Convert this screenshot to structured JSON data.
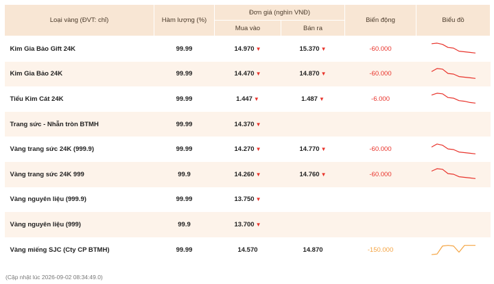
{
  "table": {
    "headers": {
      "name": "Loại vàng (ĐVT: chỉ)",
      "purity": "Hàm lượng (%)",
      "price_group": "Đơn giá (nghìn VNĐ)",
      "buy": "Mua vào",
      "sell": "Bán ra",
      "change": "Biến động",
      "chart": "Biểu đồ"
    },
    "rows": [
      {
        "name": "Kim Gia Bảo Gift 24K",
        "purity": "99.99",
        "buy": "14.970",
        "buy_arrow": "▼",
        "sell": "15.370",
        "sell_arrow": "▼",
        "change": "-60.000",
        "trend": [
          0.9,
          0.95,
          0.85,
          0.6,
          0.55,
          0.3,
          0.25,
          0.2,
          0.15
        ],
        "trend_color": "#e8322a"
      },
      {
        "name": "Kim Gia Bảo 24K",
        "purity": "99.99",
        "buy": "14.470",
        "buy_arrow": "▼",
        "sell": "14.870",
        "sell_arrow": "▼",
        "change": "-60.000",
        "trend": [
          0.7,
          0.95,
          0.9,
          0.55,
          0.5,
          0.3,
          0.25,
          0.2,
          0.15
        ],
        "trend_color": "#e8322a"
      },
      {
        "name": "Tiểu Kim Cát 24K",
        "purity": "99.99",
        "buy": "1.447",
        "buy_arrow": "▼",
        "sell": "1.487",
        "sell_arrow": "▼",
        "change": "-6.000",
        "trend": [
          0.8,
          0.95,
          0.9,
          0.6,
          0.55,
          0.35,
          0.3,
          0.2,
          0.15
        ],
        "trend_color": "#e8322a"
      },
      {
        "name": "Trang sức - Nhẫn tròn BTMH",
        "purity": "99.99",
        "buy": "14.370",
        "buy_arrow": "▼",
        "sell": "",
        "sell_arrow": "",
        "change": "",
        "trend": [],
        "trend_color": "#e8322a"
      },
      {
        "name": "Vàng trang sức 24K (999.9)",
        "purity": "99.99",
        "buy": "14.270",
        "buy_arrow": "▼",
        "sell": "14.770",
        "sell_arrow": "▼",
        "change": "-60.000",
        "trend": [
          0.7,
          0.95,
          0.85,
          0.55,
          0.5,
          0.3,
          0.25,
          0.2,
          0.15
        ],
        "trend_color": "#e8322a"
      },
      {
        "name": "Vàng trang sức 24K 999",
        "purity": "99.9",
        "buy": "14.260",
        "buy_arrow": "▼",
        "sell": "14.760",
        "sell_arrow": "▼",
        "change": "-60.000",
        "trend": [
          0.75,
          0.95,
          0.9,
          0.55,
          0.5,
          0.3,
          0.25,
          0.2,
          0.15
        ],
        "trend_color": "#e8322a"
      },
      {
        "name": "Vàng nguyên liệu (999.9)",
        "purity": "99.99",
        "buy": "13.750",
        "buy_arrow": "▼",
        "sell": "",
        "sell_arrow": "",
        "change": "",
        "trend": [],
        "trend_color": "#e8322a"
      },
      {
        "name": "Vàng nguyên liệu (999)",
        "purity": "99.9",
        "buy": "13.700",
        "buy_arrow": "▼",
        "sell": "",
        "sell_arrow": "",
        "change": "",
        "trend": [],
        "trend_color": "#e8322a"
      },
      {
        "name": "Vàng miếng SJC (Cty CP BTMH)",
        "purity": "99.99",
        "buy": "14.570",
        "buy_arrow": "",
        "sell": "14.870",
        "sell_arrow": "",
        "change": "-150.000",
        "trend": [
          0.1,
          0.15,
          0.8,
          0.85,
          0.8,
          0.3,
          0.85,
          0.85,
          0.85
        ],
        "trend_color": "#f4a340",
        "change_style": "orange"
      }
    ]
  },
  "footnote": "(Cập nhật lúc 2026-09-02 08:34:49.0)"
}
